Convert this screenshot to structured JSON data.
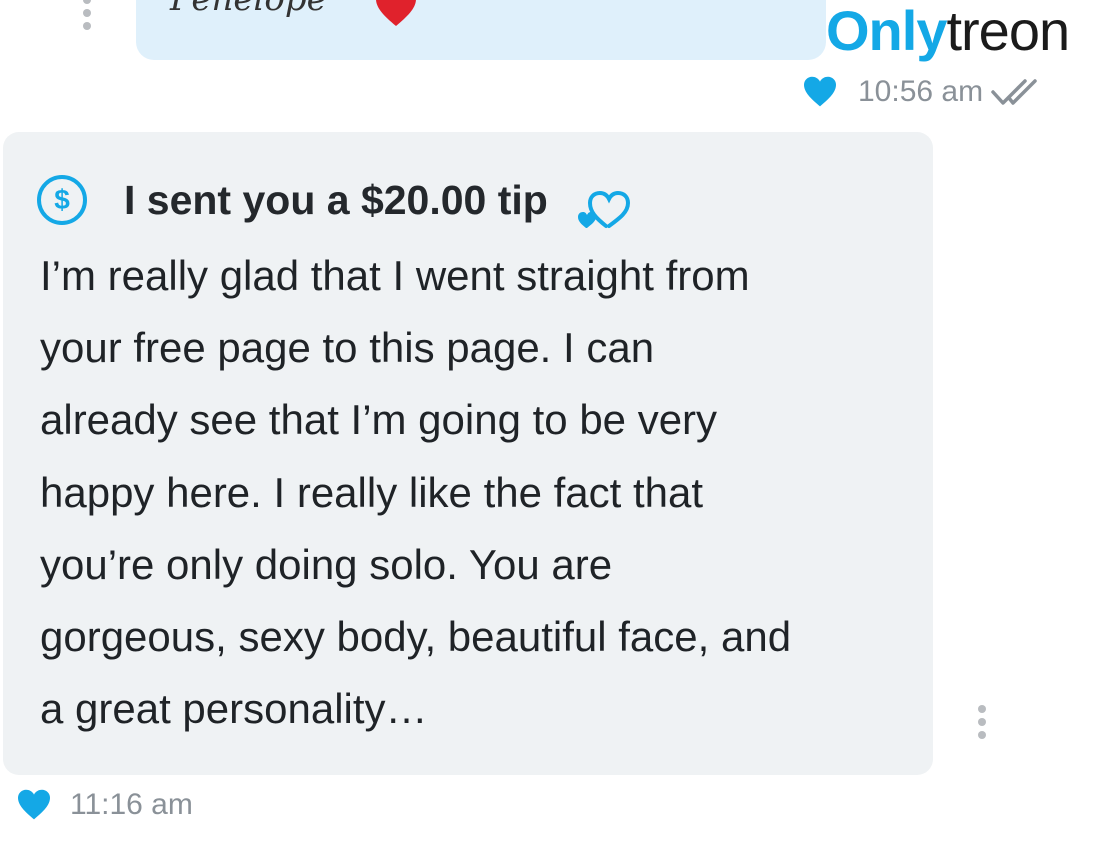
{
  "watermark": {
    "part1": "Only",
    "part2": "treon"
  },
  "sent_message": {
    "text": "Penelope",
    "time": "10:56 am",
    "emoji": "heart-emoji"
  },
  "received_message": {
    "tip_label": "I sent you a $20.00 tip",
    "tip_icon": "dollar-circle-icon",
    "body": "I’m really glad that I went straight from\nyour free page to this page. I can\nalready see that I’m going to be very\nhappy here. I really like the fact that\nyou’re only doing solo. You are\ngorgeous, sexy body, beautiful face, and\na great personality…",
    "time": "11:16 am"
  },
  "colors": {
    "accent": "#14a8e6",
    "sent_bubble": "#dff0fb",
    "received_bubble": "#eff2f4",
    "heart_emoji": "#e0222c",
    "timestamp": "#8a9198"
  }
}
